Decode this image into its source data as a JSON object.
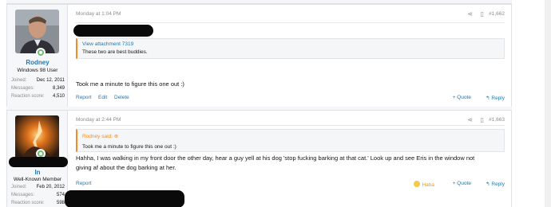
{
  "post1": {
    "user": {
      "name": "Rodney",
      "title": "Windows 98 User",
      "joined_label": "Joined:",
      "joined": "Dec 12, 2011",
      "messages_label": "Messages:",
      "messages": "8,349",
      "reaction_label": "Reaction score:",
      "reaction": "4,510"
    },
    "date": "Monday at 1:04 PM",
    "number": "#1,662",
    "quote": {
      "attachment": "View attachment 7319",
      "body": "These two are best buddies."
    },
    "text": "Took me a minute to figure this one out :)",
    "actions": {
      "report": "Report",
      "edit": "Edit",
      "delete": "Delete",
      "quote": "+ Quote",
      "reply": "↰ Reply"
    }
  },
  "post2": {
    "user": {
      "name": "In",
      "title": "Well-Known Member",
      "joined_label": "Joined:",
      "joined": "Feb 20, 2012",
      "messages_label": "Messages:",
      "messages": "574",
      "reaction_label": "Reaction score:",
      "reaction": "598"
    },
    "date": "Monday at 2:44 PM",
    "number": "#1,663",
    "quote": {
      "head": "Rodney said:",
      "body": "Took me a minute to figure this one out :)"
    },
    "text_line1": "Hahha, I was walking in my front door the other day, hear a guy yell at his dog 'stop fucking barking at that cat.' Look up and see Eris in the window not",
    "text_line2": "giving af about the dog barking at her.",
    "actions": {
      "report": "Report",
      "reaction": "Haha",
      "quote": "+ Quote",
      "reply": "↰ Reply"
    }
  },
  "icons": {
    "share": "share-icon",
    "bookmark": "bookmark-icon",
    "online": "online-indicator-icon"
  },
  "colors": {
    "link": "#2577b1",
    "quote_accent": "#f28c28",
    "online": "#6fbf73"
  }
}
